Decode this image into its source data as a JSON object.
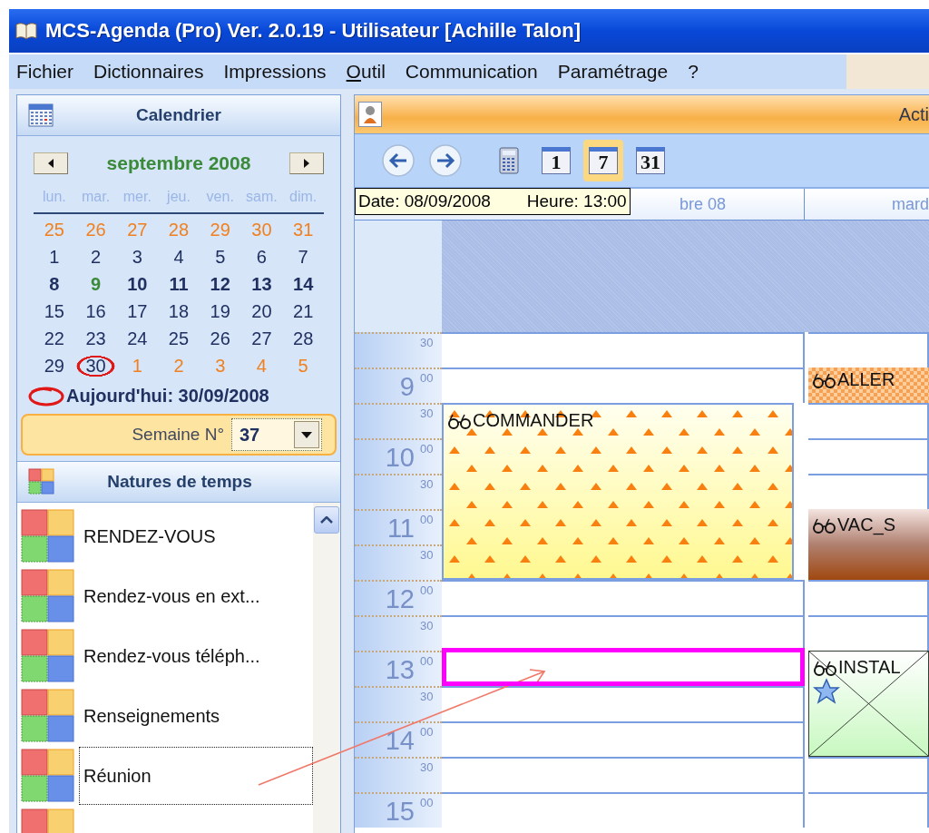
{
  "window": {
    "title": "MCS-Agenda (Pro) Ver. 2.0.19 - Utilisateur [Achille Talon]"
  },
  "menu": [
    {
      "label": "Fichier",
      "mnemonic": false
    },
    {
      "label": "Dictionnaires",
      "mnemonic": false
    },
    {
      "label": "Impressions",
      "mnemonic": false
    },
    {
      "label": "Outil",
      "mnemonic": true
    },
    {
      "label": "Communication",
      "mnemonic": false
    },
    {
      "label": "Paramétrage",
      "mnemonic": false
    },
    {
      "label": "?",
      "mnemonic": false
    }
  ],
  "calendar": {
    "title": "Calendrier",
    "month": "septembre 2008",
    "weekdays": [
      "lun.",
      "mar.",
      "mer.",
      "jeu.",
      "ven.",
      "sam.",
      "dim."
    ],
    "weeks": [
      {
        "selected": false,
        "days": [
          {
            "day": "25",
            "kind": "outside"
          },
          {
            "day": "26",
            "kind": "outside"
          },
          {
            "day": "27",
            "kind": "outside"
          },
          {
            "day": "28",
            "kind": "outside"
          },
          {
            "day": "29",
            "kind": "outside"
          },
          {
            "day": "30",
            "kind": "outside"
          },
          {
            "day": "31",
            "kind": "outside"
          }
        ]
      },
      {
        "selected": false,
        "days": [
          {
            "day": "1",
            "kind": "normal"
          },
          {
            "day": "2",
            "kind": "normal"
          },
          {
            "day": "3",
            "kind": "normal"
          },
          {
            "day": "4",
            "kind": "normal"
          },
          {
            "day": "5",
            "kind": "normal"
          },
          {
            "day": "6",
            "kind": "normal"
          },
          {
            "day": "7",
            "kind": "normal"
          }
        ]
      },
      {
        "selected": true,
        "days": [
          {
            "day": "8",
            "kind": "normal"
          },
          {
            "day": "9",
            "kind": "focus"
          },
          {
            "day": "10",
            "kind": "normal"
          },
          {
            "day": "11",
            "kind": "normal"
          },
          {
            "day": "12",
            "kind": "normal"
          },
          {
            "day": "13",
            "kind": "normal"
          },
          {
            "day": "14",
            "kind": "normal"
          }
        ]
      },
      {
        "selected": false,
        "days": [
          {
            "day": "15",
            "kind": "normal"
          },
          {
            "day": "16",
            "kind": "normal"
          },
          {
            "day": "17",
            "kind": "normal"
          },
          {
            "day": "18",
            "kind": "normal"
          },
          {
            "day": "19",
            "kind": "normal"
          },
          {
            "day": "20",
            "kind": "normal"
          },
          {
            "day": "21",
            "kind": "normal"
          }
        ]
      },
      {
        "selected": false,
        "days": [
          {
            "day": "22",
            "kind": "normal"
          },
          {
            "day": "23",
            "kind": "normal"
          },
          {
            "day": "24",
            "kind": "normal"
          },
          {
            "day": "25",
            "kind": "normal"
          },
          {
            "day": "26",
            "kind": "normal"
          },
          {
            "day": "27",
            "kind": "normal"
          },
          {
            "day": "28",
            "kind": "normal"
          }
        ]
      },
      {
        "selected": false,
        "days": [
          {
            "day": "29",
            "kind": "normal"
          },
          {
            "day": "30",
            "kind": "today"
          },
          {
            "day": "1",
            "kind": "outside"
          },
          {
            "day": "2",
            "kind": "outside"
          },
          {
            "day": "3",
            "kind": "outside"
          },
          {
            "day": "4",
            "kind": "outside"
          },
          {
            "day": "5",
            "kind": "outside"
          }
        ]
      }
    ],
    "today": "Aujourd'hui: 30/09/2008",
    "week_label": "Semaine N°",
    "week_value": "37"
  },
  "natures": {
    "title": "Natures de temps",
    "items": [
      {
        "label": "RENDEZ-VOUS",
        "selected": false
      },
      {
        "label": "Rendez-vous en ext...",
        "selected": false
      },
      {
        "label": "Rendez-vous téléph...",
        "selected": false
      },
      {
        "label": "Renseignements",
        "selected": false
      },
      {
        "label": "Réunion",
        "selected": true
      }
    ]
  },
  "agenda": {
    "header_title": "Acti",
    "toolbar": [
      {
        "kind": "back",
        "selected": false
      },
      {
        "kind": "forward",
        "selected": false
      },
      {
        "kind": "calculator",
        "selected": false
      },
      {
        "kind": "view",
        "label": "1",
        "selected": false
      },
      {
        "kind": "view",
        "label": "7",
        "selected": true
      },
      {
        "kind": "view",
        "label": "31",
        "selected": false
      }
    ],
    "tooltip": {
      "date": "Date: 08/09/2008",
      "time": "Heure: 13:00"
    },
    "slots": [
      {
        "minute": "30"
      },
      {
        "hour": "9",
        "minute": "00"
      },
      {
        "minute": "30"
      },
      {
        "hour": "10",
        "minute": "00"
      },
      {
        "minute": "30"
      },
      {
        "hour": "11",
        "minute": "00"
      },
      {
        "minute": "30"
      },
      {
        "hour": "12",
        "minute": "00"
      },
      {
        "minute": "30"
      },
      {
        "hour": "13",
        "minute": "00"
      },
      {
        "minute": "30"
      },
      {
        "hour": "14",
        "minute": "00"
      },
      {
        "minute": "30"
      },
      {
        "hour": "15",
        "minute": "00"
      }
    ],
    "days": [
      {
        "header": "bre 08",
        "cells": [
          {
            "kind": "empty"
          },
          {
            "kind": "empty"
          },
          {
            "kind": "event",
            "event": {
              "kind": "triangles",
              "title": "COMMANDER",
              "starred": false
            }
          },
          {
            "kind": "continued"
          },
          {
            "kind": "continued"
          },
          {
            "kind": "continued"
          },
          {
            "kind": "continued"
          },
          {
            "kind": "empty"
          },
          {
            "kind": "empty"
          },
          {
            "kind": "selected"
          },
          {
            "kind": "empty"
          },
          {
            "kind": "empty"
          },
          {
            "kind": "empty"
          },
          {
            "kind": "empty"
          }
        ]
      },
      {
        "header": "mard",
        "cells": [
          {
            "kind": "empty"
          },
          {
            "kind": "event",
            "event": {
              "kind": "checkered",
              "title": "ALLER",
              "starred": false
            }
          },
          {
            "kind": "empty"
          },
          {
            "kind": "empty"
          },
          {
            "kind": "empty"
          },
          {
            "kind": "event",
            "event": {
              "kind": "brown",
              "title": "VAC_S",
              "starred": false
            }
          },
          {
            "kind": "continued"
          },
          {
            "kind": "empty"
          },
          {
            "kind": "empty"
          },
          {
            "kind": "event",
            "event": {
              "kind": "crossed",
              "title": "INSTAL",
              "starred": true
            }
          },
          {
            "kind": "continued"
          },
          {
            "kind": "continued"
          },
          {
            "kind": "empty"
          },
          {
            "kind": "empty"
          }
        ]
      }
    ]
  }
}
